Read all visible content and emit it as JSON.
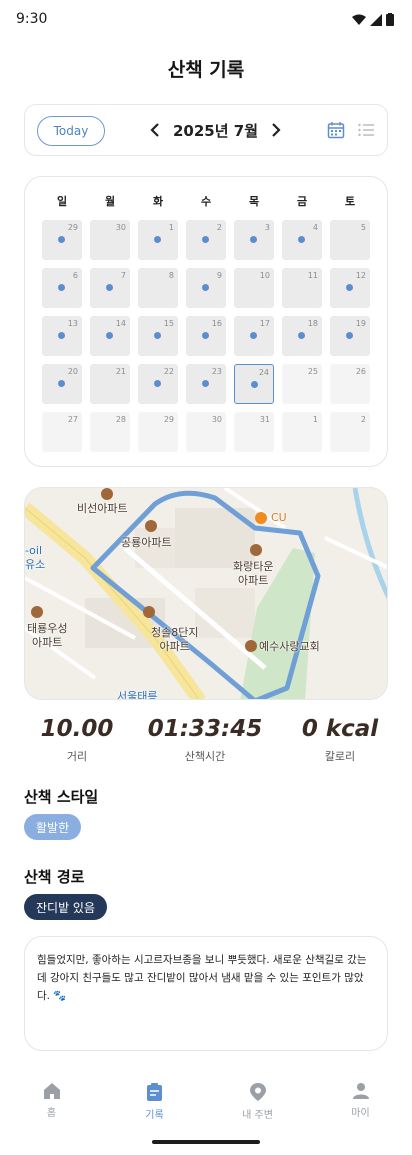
{
  "status_bar": {
    "time": "9:30"
  },
  "header": {
    "title": "산책 기록"
  },
  "date_selector": {
    "today_label": "Today",
    "month_label": "2025년 7월",
    "prev_icon": "chevron-left-icon",
    "next_icon": "chevron-right-icon",
    "calendar_view_icon": "calendar-icon",
    "list_view_icon": "list-icon",
    "accent_color": "#5a8fcf"
  },
  "calendar": {
    "weekdays": [
      "일",
      "월",
      "화",
      "수",
      "목",
      "금",
      "토"
    ],
    "days": [
      {
        "num": "29",
        "walk": true,
        "current": true
      },
      {
        "num": "30",
        "walk": false,
        "current": true
      },
      {
        "num": "1",
        "walk": true,
        "current": true
      },
      {
        "num": "2",
        "walk": true,
        "current": true
      },
      {
        "num": "3",
        "walk": true,
        "current": true
      },
      {
        "num": "4",
        "walk": true,
        "current": true
      },
      {
        "num": "5",
        "walk": false,
        "current": true
      },
      {
        "num": "6",
        "walk": true,
        "current": true
      },
      {
        "num": "7",
        "walk": true,
        "current": true
      },
      {
        "num": "8",
        "walk": false,
        "current": true
      },
      {
        "num": "9",
        "walk": true,
        "current": true
      },
      {
        "num": "10",
        "walk": false,
        "current": true
      },
      {
        "num": "11",
        "walk": false,
        "current": true
      },
      {
        "num": "12",
        "walk": true,
        "current": true
      },
      {
        "num": "13",
        "walk": true,
        "current": true
      },
      {
        "num": "14",
        "walk": true,
        "current": true
      },
      {
        "num": "15",
        "walk": true,
        "current": true
      },
      {
        "num": "16",
        "walk": true,
        "current": true
      },
      {
        "num": "17",
        "walk": true,
        "current": true
      },
      {
        "num": "18",
        "walk": true,
        "current": true
      },
      {
        "num": "19",
        "walk": true,
        "current": true
      },
      {
        "num": "20",
        "walk": true,
        "current": true
      },
      {
        "num": "21",
        "walk": false,
        "current": true
      },
      {
        "num": "22",
        "walk": true,
        "current": true
      },
      {
        "num": "23",
        "walk": true,
        "current": true
      },
      {
        "num": "24",
        "walk": true,
        "current": true,
        "selected": true
      },
      {
        "num": "25",
        "walk": false,
        "current": false
      },
      {
        "num": "26",
        "walk": false,
        "current": false
      },
      {
        "num": "27",
        "walk": false,
        "current": false
      },
      {
        "num": "28",
        "walk": false,
        "current": false
      },
      {
        "num": "29",
        "walk": false,
        "current": false
      },
      {
        "num": "30",
        "walk": false,
        "current": false
      },
      {
        "num": "31",
        "walk": false,
        "current": false
      },
      {
        "num": "1",
        "walk": false,
        "current": false
      },
      {
        "num": "2",
        "walk": false,
        "current": false
      }
    ]
  },
  "map": {
    "labels": {
      "l1": "비선아파트",
      "l2": "공룡아파트",
      "l3": "화랑타운\n아파트",
      "l4": "태룡우성\n아파트",
      "l5": "청솔8단지\n아파트",
      "l6": "예수사랑교회",
      "l7": "CU",
      "l8": "-oil\n유소",
      "l9": "서울태릉"
    },
    "route_color": "#6f9fd6"
  },
  "stats": {
    "distance_value": "10.00",
    "distance_label": "거리",
    "time_value": "01:33:45",
    "time_label": "산책시간",
    "calorie_value": "0 kcal",
    "calorie_label": "칼로리"
  },
  "style_section": {
    "title": "산책 스타일",
    "tag": "활발한"
  },
  "route_section": {
    "title": "산책 경로",
    "tag": "잔디밭 있음"
  },
  "memo": {
    "text": "힘들었지만, 좋아하는 시고르자브종을 보니 뿌듯했다. 새로운 산책길로 갔는데 강아지 친구들도 많고 잔디밭이 많아서 냄새 맡을 수 있는 포인트가 많았다. 🐾"
  },
  "bottom_nav": {
    "items": [
      {
        "label": "홈",
        "icon": "home-icon"
      },
      {
        "label": "기록",
        "icon": "record-icon"
      },
      {
        "label": "내 주변",
        "icon": "location-pin-icon"
      },
      {
        "label": "마이",
        "icon": "person-icon"
      }
    ]
  }
}
